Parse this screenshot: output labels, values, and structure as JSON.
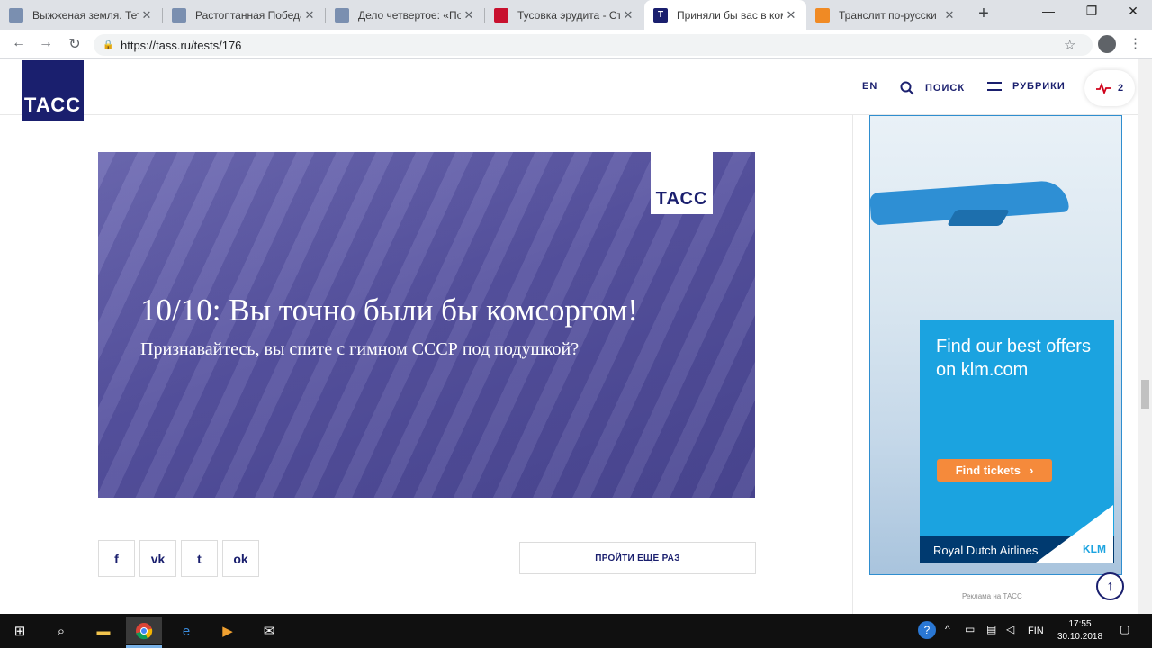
{
  "browser": {
    "tabs": [
      {
        "title": "Выжженая земля. Тетр",
        "favicon": "book-icon",
        "active": false
      },
      {
        "title": "Растоптанная Победа.",
        "favicon": "book-icon",
        "active": false
      },
      {
        "title": "Дело четвертое: «Пов",
        "favicon": "book-icon",
        "active": false
      },
      {
        "title": "Тусовка эрудита - Стр",
        "favicon": "red-logo-icon",
        "active": false
      },
      {
        "title": "Приняли бы вас в ком",
        "favicon": "tass-t-icon",
        "active": true
      },
      {
        "title": "Транслит по-русски",
        "favicon": "orange-square-icon",
        "active": false
      }
    ],
    "url": "https://tass.ru/tests/176"
  },
  "header": {
    "logo": "ТАСС",
    "lang": "EN",
    "search": "ПОИСК",
    "rubrics": "РУБРИКИ",
    "pulse_count": "2"
  },
  "hero": {
    "logo": "ТАСС",
    "title": "10/10: Вы точно были бы комсоргом!",
    "subtitle": "Признавайтесь, вы спите с гимном СССР под подушкой?"
  },
  "share": [
    {
      "name": "facebook-share-button",
      "glyph": "f"
    },
    {
      "name": "vk-share-button",
      "glyph": "vk"
    },
    {
      "name": "twitter-share-button",
      "glyph": "t"
    },
    {
      "name": "odnoklassniki-share-button",
      "glyph": "ok"
    }
  ],
  "retry_label": "ПРОЙТИ ЕЩЕ РАЗ",
  "ad": {
    "headline": "Find our best offers on klm.com",
    "button": "Find tickets",
    "footer": "Royal Dutch Airlines",
    "badge": "KLM",
    "caption": "Реклама на ТАСС"
  },
  "taskbar": {
    "lang": "FIN",
    "time": "17:55",
    "date": "30.10.2018"
  },
  "colors": {
    "brand": "#1a1f6e",
    "klm_blue": "#1ba3e0",
    "klm_orange": "#f58a3b"
  }
}
